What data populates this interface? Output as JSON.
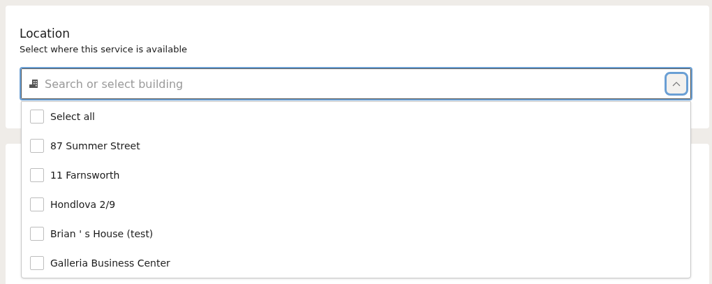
{
  "location": {
    "title": "Location",
    "subtitle": "Select where this service is available",
    "search": {
      "placeholder": "Search or select building",
      "expanded": true
    },
    "options": [
      {
        "label": "Select all",
        "checked": false
      },
      {
        "label": "87 Summer Street",
        "checked": false
      },
      {
        "label": "11 Farnsworth",
        "checked": false
      },
      {
        "label": "Hondlova 2/9",
        "checked": false
      },
      {
        "label": "Brian ' s House (test)",
        "checked": false
      },
      {
        "label": "Galleria Business Center",
        "checked": false
      }
    ]
  }
}
